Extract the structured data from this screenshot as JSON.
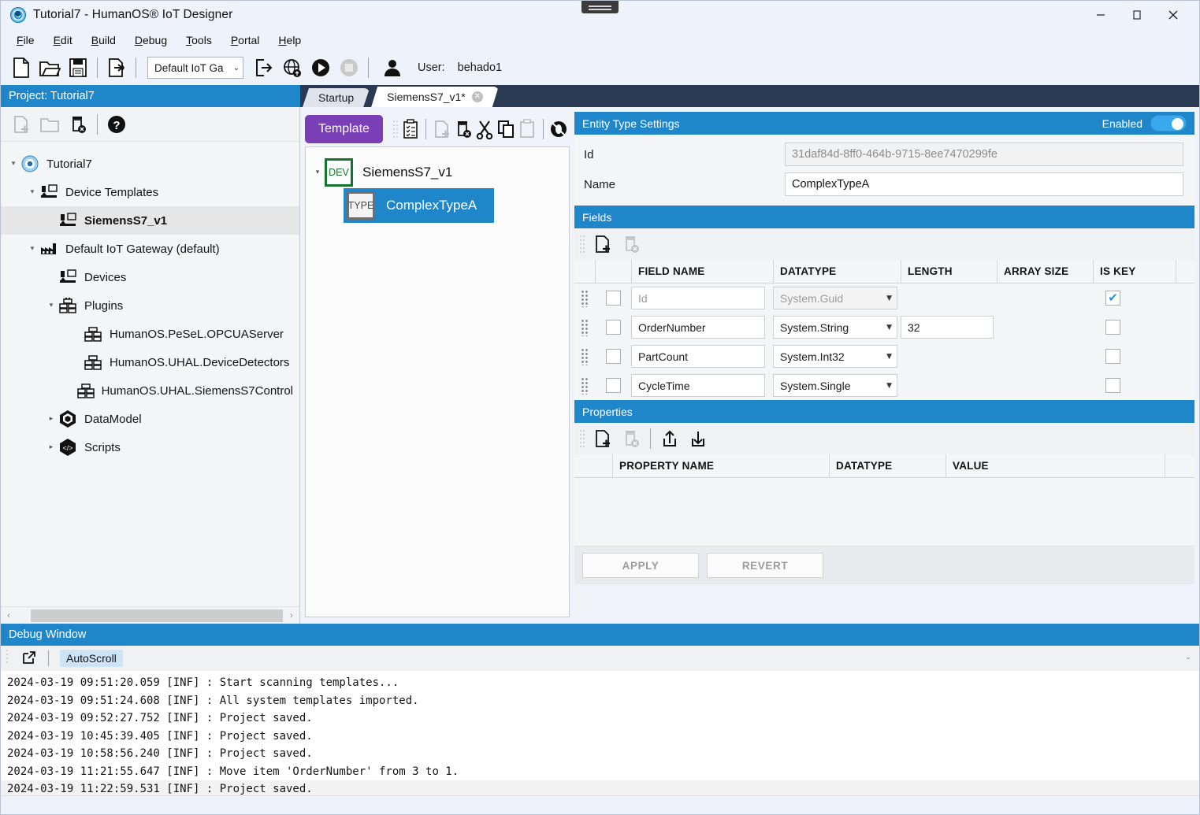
{
  "window": {
    "title": "Tutorial7 - HumanOS® IoT Designer",
    "minimize": "–",
    "maximize": "□",
    "close": "✕"
  },
  "menu": [
    {
      "label": "File",
      "accel": "F"
    },
    {
      "label": "Edit",
      "accel": "E"
    },
    {
      "label": "Build",
      "accel": "B"
    },
    {
      "label": "Debug",
      "accel": "D"
    },
    {
      "label": "Tools",
      "accel": "T"
    },
    {
      "label": "Portal",
      "accel": "P"
    },
    {
      "label": "Help",
      "accel": "H"
    }
  ],
  "toolbar": {
    "icons": [
      "new-file-icon",
      "open-folder-icon",
      "save-icon",
      "deploy-icon"
    ],
    "gateway_select": "Default IoT Ga",
    "gateway_arrow": "⌄",
    "export_icon": "export-icon",
    "globe_icon": "globe-upload-icon",
    "run_icon": "run-icon",
    "stop_icon": "stop-icon",
    "user_icon": "user-icon",
    "user_label": "User:",
    "user_name": "behado1"
  },
  "project_header": "Project: Tutorial7",
  "tabs": [
    {
      "label": "Startup",
      "active": false,
      "closable": false
    },
    {
      "label": "SiemensS7_v1*",
      "active": true,
      "closable": true,
      "close_glyph": "✕"
    }
  ],
  "left_toolbar": {
    "add_icon": "add-item-icon",
    "open_icon": "open-item-icon",
    "delete_icon": "delete-item-icon",
    "help_icon": "help-icon"
  },
  "tree": [
    {
      "label": "Tutorial7",
      "indent": 0,
      "caret": "▾",
      "icon": "project-icon",
      "selected": false
    },
    {
      "label": "Device Templates",
      "indent": 1,
      "caret": "▾",
      "icon": "device-template-icon",
      "selected": false
    },
    {
      "label": "SiemensS7_v1",
      "indent": 2,
      "caret": "",
      "icon": "device-template-icon",
      "selected": true
    },
    {
      "label": "Default IoT Gateway (default)",
      "indent": 1,
      "caret": "▾",
      "icon": "gateway-icon",
      "selected": false
    },
    {
      "label": "Devices",
      "indent": 2,
      "caret": "",
      "icon": "device-template-icon",
      "selected": false
    },
    {
      "label": "Plugins",
      "indent": 2,
      "caret": "▾",
      "icon": "plugin-icon",
      "selected": false
    },
    {
      "label": "HumanOS.PeSeL.OPCUAServer",
      "indent": 3,
      "caret": "",
      "icon": "plugin-icon",
      "selected": false
    },
    {
      "label": "HumanOS.UHAL.DeviceDetectors",
      "indent": 3,
      "caret": "",
      "icon": "plugin-icon",
      "selected": false
    },
    {
      "label": "HumanOS.UHAL.SiemensS7Control",
      "indent": 3,
      "caret": "",
      "icon": "plugin-icon",
      "selected": false
    },
    {
      "label": "DataModel",
      "indent": 2,
      "caret": "▸",
      "icon": "datamodel-icon",
      "selected": false
    },
    {
      "label": "Scripts",
      "indent": 2,
      "caret": "▸",
      "icon": "scripts-icon",
      "selected": false
    }
  ],
  "tree_scroll": {
    "left_arrow": "‹",
    "right_arrow": "›"
  },
  "template_pane": {
    "template_button": "Template",
    "icons": [
      "checklist-icon",
      "add-type-icon",
      "delete-type-icon",
      "cut-icon",
      "copy-icon",
      "paste-icon",
      "debug-disabled-icon"
    ],
    "root": {
      "badge": "DEV",
      "label": "SiemensS7_v1",
      "caret": "▾"
    },
    "child": {
      "badge": "TYPE",
      "label": "ComplexTypeA"
    }
  },
  "entity_settings": {
    "header": "Entity Type Settings",
    "enabled_label": "Enabled",
    "enabled": true,
    "id_label": "Id",
    "id_value": "31daf84d-8ff0-464b-9715-8ee7470299fe",
    "name_label": "Name",
    "name_value": "ComplexTypeA"
  },
  "fields": {
    "header": "Fields",
    "toolbar_icons": [
      "add-field-icon",
      "delete-field-icon"
    ],
    "columns": [
      "",
      "",
      "FIELD NAME",
      "DATATYPE",
      "LENGTH",
      "ARRAY SIZE",
      "IS KEY",
      ""
    ],
    "rows": [
      {
        "selected": false,
        "name": "Id",
        "name_placeholder": true,
        "datatype": "System.Guid",
        "datatype_disabled": true,
        "length": "",
        "array_size": "",
        "is_key": true
      },
      {
        "selected": false,
        "name": "OrderNumber",
        "name_placeholder": false,
        "datatype": "System.String",
        "datatype_disabled": false,
        "length": "32",
        "array_size": "",
        "is_key": false
      },
      {
        "selected": false,
        "name": "PartCount",
        "name_placeholder": false,
        "datatype": "System.Int32",
        "datatype_disabled": false,
        "length": "",
        "array_size": "",
        "is_key": false
      },
      {
        "selected": false,
        "name": "CycleTime",
        "name_placeholder": false,
        "datatype": "System.Single",
        "datatype_disabled": false,
        "length": "",
        "array_size": "",
        "is_key": false
      }
    ]
  },
  "properties": {
    "header": "Properties",
    "toolbar_icons": [
      "add-property-icon",
      "delete-property-icon",
      "import-icon",
      "export-icon"
    ],
    "columns": [
      "",
      "PROPERTY NAME",
      "DATATYPE",
      "VALUE",
      ""
    ],
    "rows": []
  },
  "actions": {
    "apply": "APPLY",
    "revert": "REVERT"
  },
  "debug": {
    "header": "Debug Window",
    "popout_icon": "popout-icon",
    "autoscroll": "AutoScroll",
    "scroll_glyph": "⌄",
    "lines": [
      {
        "text": "2024-03-19 09:51:20.059 [INF] : Start scanning templates...",
        "highlight": false
      },
      {
        "text": "2024-03-19 09:51:24.608 [INF] : All system templates imported.",
        "highlight": false
      },
      {
        "text": "2024-03-19 09:52:27.752 [INF] : Project saved.",
        "highlight": false
      },
      {
        "text": "2024-03-19 10:45:39.405 [INF] : Project saved.",
        "highlight": false
      },
      {
        "text": "2024-03-19 10:58:56.240 [INF] : Project saved.",
        "highlight": false
      },
      {
        "text": "2024-03-19 11:21:55.647 [INF] : Move item 'OrderNumber' from 3 to 1.",
        "highlight": false
      },
      {
        "text": "2024-03-19 11:22:59.531 [INF] : Project saved.",
        "highlight": true
      }
    ]
  },
  "colors": {
    "accent_blue": "#1f86c9",
    "template_purple": "#7a3fb5",
    "tab_bar_navy": "#2b3a53",
    "dev_green": "#16722f",
    "checkbox_blue": "#2f8fdd"
  }
}
